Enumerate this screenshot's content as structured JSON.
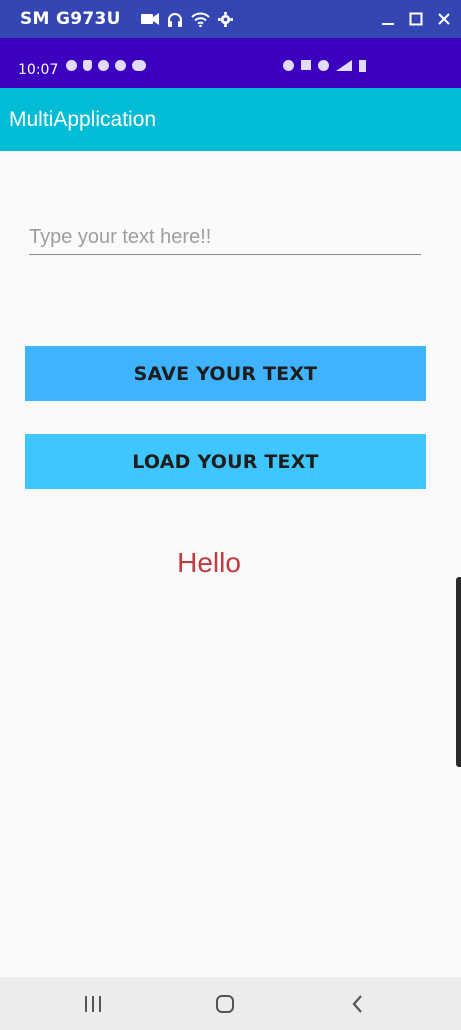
{
  "window": {
    "title": "SM G973U",
    "icons": [
      "video-camera-icon",
      "headphones-icon",
      "wifi-icon",
      "gear-icon"
    ],
    "controls": [
      "minimize-icon",
      "maximize-icon",
      "close-icon"
    ]
  },
  "status_bar": {
    "time": "10:07",
    "left_icons": [
      "whatsapp-icon",
      "bell-icon",
      "at-sign-icon",
      "chat-icon",
      "cloud-icon"
    ],
    "right_icons": [
      "alarm-icon",
      "mute-icon",
      "wifi-calling-icon",
      "signal-icon",
      "battery-icon"
    ]
  },
  "app_bar": {
    "title": "MultiApplication"
  },
  "form": {
    "text_field": {
      "placeholder": "Type your text here!!",
      "value": ""
    },
    "save_button": "SAVE YOUR TEXT",
    "load_button": "LOAD YOUR TEXT",
    "output_text": "Hello"
  },
  "nav_bar": {
    "buttons": [
      "recents-icon",
      "home-icon",
      "back-icon"
    ]
  },
  "colors": {
    "window_bar": "#3446b3",
    "status_bar": "#3c00bf",
    "app_bar": "#00bcd4",
    "button": "#40b3ff",
    "output_text": "#c03a42"
  }
}
